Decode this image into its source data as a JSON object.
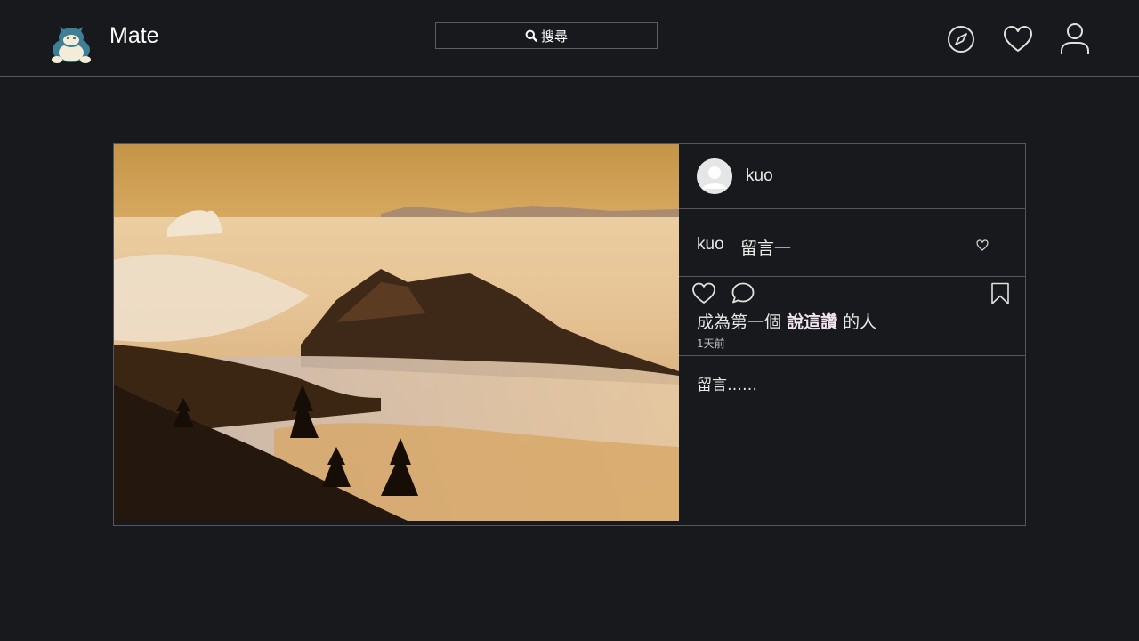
{
  "header": {
    "brand": "Mate",
    "search_label": "搜尋",
    "icons": [
      "logo-icon",
      "search-icon",
      "compass-icon",
      "heart-icon",
      "user-icon"
    ]
  },
  "post": {
    "author": "kuo",
    "comments": [
      {
        "user": "kuo",
        "text": "留言一"
      }
    ],
    "likes_prefix": "成為第一個",
    "likes_action": "說這讚",
    "likes_suffix": "的人",
    "time": "1天前",
    "comment_placeholder": "留言……",
    "icons": [
      "like-icon",
      "comment-icon",
      "bookmark-icon",
      "avatar-icon",
      "comment-like-icon"
    ]
  },
  "colors": {
    "background": "#18191c",
    "border": "#55565a",
    "text": "#e8e8e8"
  }
}
